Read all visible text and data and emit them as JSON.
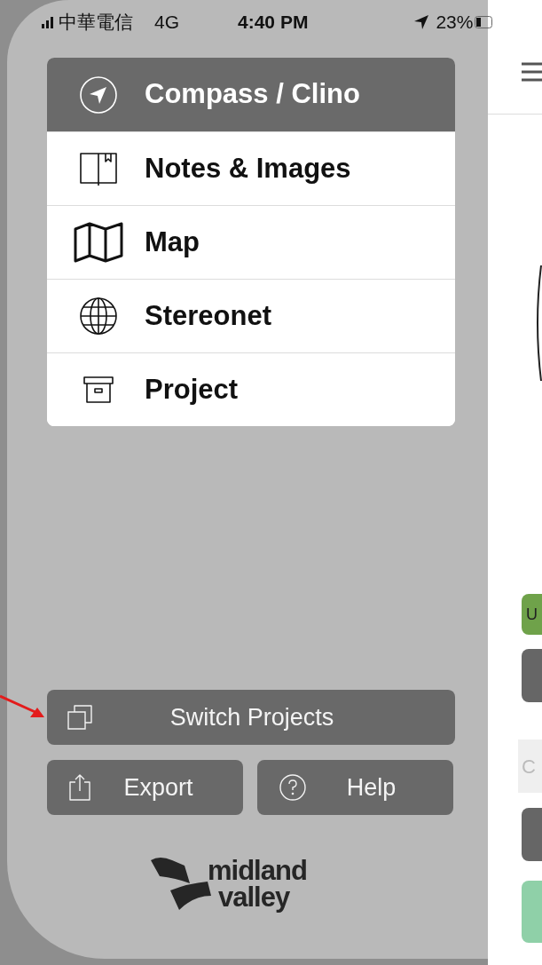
{
  "status_bar": {
    "carrier": "中華電信",
    "network": "4G",
    "time": "4:40 PM",
    "battery": "23%"
  },
  "menu": [
    {
      "label": "Compass / Clino",
      "kind": "compass",
      "selected": true
    },
    {
      "label": "Notes & Images",
      "kind": "notebook",
      "selected": false
    },
    {
      "label": "Map",
      "kind": "map",
      "selected": false
    },
    {
      "label": "Stereonet",
      "kind": "globe",
      "selected": false
    },
    {
      "label": "Project",
      "kind": "archive",
      "selected": false
    }
  ],
  "actions": [
    {
      "label": "Switch Projects",
      "kind": "switch"
    },
    {
      "label": "Export",
      "kind": "export"
    },
    {
      "label": "Help",
      "kind": "help"
    }
  ],
  "logo": {
    "line_1": "midland",
    "line_2": "valley"
  },
  "background_screen": {
    "button_text": "U",
    "field_text": "C"
  }
}
